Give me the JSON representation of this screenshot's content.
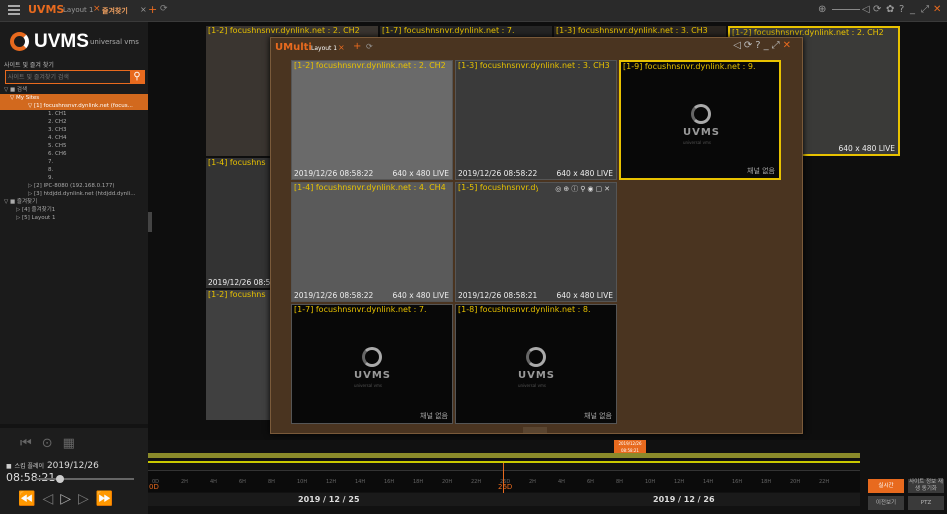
{
  "app": {
    "brand": "UVMS",
    "tabs": [
      {
        "label": "Layout 1"
      },
      {
        "label": "즐겨찾기"
      }
    ]
  },
  "sidebar": {
    "logo_word": "UVMS",
    "logo_sub": "universal vms",
    "title": "사이트 및 즐겨 찾기",
    "search_placeholder": "사이트 및 즐겨찾기 검색",
    "tree": [
      {
        "label": "▽ ■ 검색",
        "indent": 4,
        "sel": false
      },
      {
        "label": "▽ My Sites",
        "indent": 10,
        "sel": true
      },
      {
        "label": "▽ [1] focushnsnvr.dynlink.net (focus...",
        "indent": 28,
        "sel": true
      },
      {
        "label": "1. CH1",
        "indent": 48,
        "sel": false
      },
      {
        "label": "2. CH2",
        "indent": 48,
        "sel": false
      },
      {
        "label": "3. CH3",
        "indent": 48,
        "sel": false
      },
      {
        "label": "4. CH4",
        "indent": 48,
        "sel": false
      },
      {
        "label": "5. CH5",
        "indent": 48,
        "sel": false
      },
      {
        "label": "6. CH6",
        "indent": 48,
        "sel": false
      },
      {
        "label": "7.",
        "indent": 48,
        "sel": false
      },
      {
        "label": "8.",
        "indent": 48,
        "sel": false
      },
      {
        "label": "9.",
        "indent": 48,
        "sel": false
      },
      {
        "label": "▷ [2] IPC-8080 (192.168.0.177)",
        "indent": 28,
        "sel": false
      },
      {
        "label": "▷ [3] htdjdd.dynlink.net (htdjdd.dynli...",
        "indent": 28,
        "sel": false
      },
      {
        "label": "▽ ■ 즐겨찾기",
        "indent": 4,
        "sel": false
      },
      {
        "label": "▷ [4] 즐겨찾기1",
        "indent": 16,
        "sel": false
      },
      {
        "label": "▷ [5] Layout 1",
        "indent": 16,
        "sel": false
      }
    ]
  },
  "control": {
    "clip_label": "스킵 플레이",
    "date": "2019/12/26",
    "time": "08:58:21"
  },
  "background_grid": {
    "headers": [
      "[1-2] focushnsnvr.dynlink.net : 2. CH2",
      "[1-7] focushnsnvr.dynlink.net : 7.",
      "[1-3] focushnsnvr.dynlink.net : 3. CH3",
      "[1-2] focushnsnvr.dynlink.net : 2. CH2"
    ],
    "left_col": [
      "[1-4] focushns",
      "[1-2] focushns"
    ],
    "ts_left": "2019/12/26 08:5",
    "res_right": "640 x 480 LIVE"
  },
  "umulti": {
    "title": "UMulti",
    "tab": "Layout 1",
    "cells": [
      {
        "hdr": "[1-2] focushnsnvr.dynlink.net : 2. CH2",
        "ts": "2019/12/26 08:58:22",
        "res": "640 x 480 LIVE"
      },
      {
        "hdr": "[1-3] focushnsnvr.dynlink.net : 3. CH3",
        "ts": "2019/12/26 08:58:22",
        "res": "640 x 480 LIVE"
      },
      {
        "hdr": "[1-9] focushnsnvr.dynlink.net : 9.",
        "none": "채널 없음"
      },
      {
        "hdr": "[1-4] focushnsnvr.dynlink.net : 4. CH4",
        "ts": "2019/12/26 08:58:22",
        "res": "640 x 480 LIVE"
      },
      {
        "hdr": "[1-5] focushnsnvr.dynlink.net : 5. CH5",
        "ts": "2019/12/26 08:58:21",
        "res": "640 x 480 LIVE"
      },
      {
        "hdr": "[1-7] focushnsnvr.dynlink.net : 7.",
        "none": "채널 없음"
      },
      {
        "hdr": "[1-8] focushnsnvr.dynlink.net : 8.",
        "none": "채널 없음"
      }
    ],
    "logo_word": "UVMS",
    "logo_tag": "universal vms"
  },
  "timeline": {
    "marker": "2019/12/26 08:58:21",
    "date_left": "2019 / 12 / 25",
    "date_right": "2019 / 12 / 26",
    "hours": [
      "0D",
      "2H",
      "4H",
      "6H",
      "8H",
      "10H",
      "12H",
      "14H",
      "16H",
      "18H",
      "20H",
      "22H",
      "26D",
      "2H",
      "4H",
      "6H",
      "8H",
      "10H",
      "12H",
      "14H",
      "16H",
      "18H",
      "20H",
      "22H"
    ],
    "start_label": "0D",
    "cursor_label": "26D",
    "right_buttons": [
      "실시간",
      "사이트 정보\n재생 동기화",
      "이전보기",
      "PTZ"
    ]
  },
  "colors": {
    "accent": "#e86a1e",
    "highlight": "#e8c200"
  }
}
